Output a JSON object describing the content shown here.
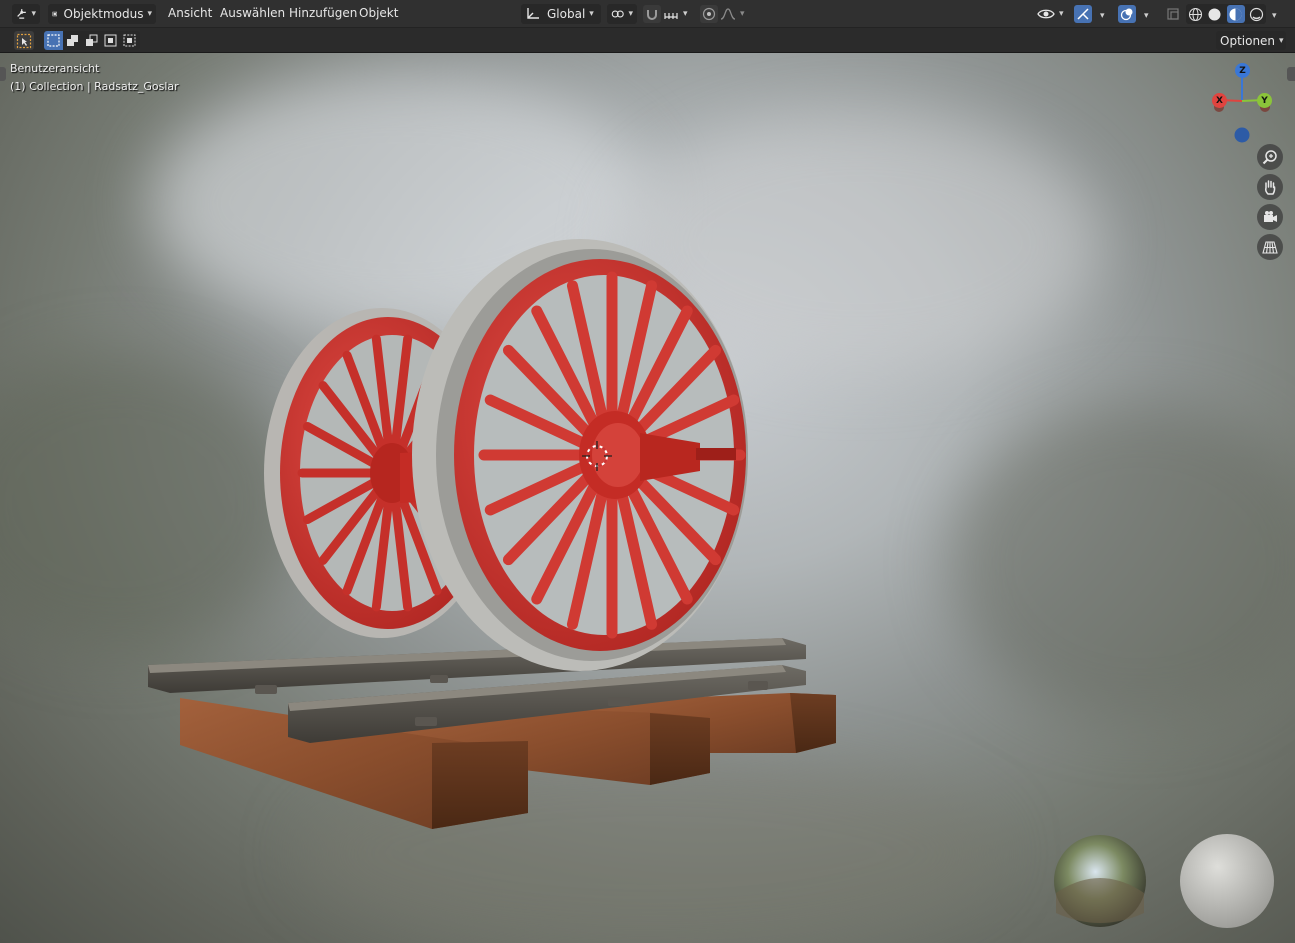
{
  "header": {
    "mode_label": "Objektmodus",
    "menus": [
      "Ansicht",
      "Auswählen",
      "Hinzufügen",
      "Objekt"
    ],
    "transform_orientation": "Global"
  },
  "toolbar": {
    "options_label": "Optionen"
  },
  "viewport": {
    "view_name": "Benutzeransicht",
    "collection_info": "(1) Collection | Radsatz_Goslar"
  },
  "gizmo": {
    "axis_x": "X",
    "axis_y": "Y",
    "axis_z": "Z",
    "colors": {
      "x": "#e0443f",
      "y": "#8bc43a",
      "z": "#3a77d6"
    }
  },
  "icons": [
    "editor-type-icon",
    "object-mode-icon",
    "transform-orientation-icon",
    "pivot-icon",
    "snap-magnet-icon",
    "snap-increment-icon",
    "proportional-edit-icon",
    "falloff-icon",
    "visibility-icon",
    "gizmo-icon",
    "overlay-icon",
    "xray-icon",
    "wireframe-shading-icon",
    "solid-shading-icon",
    "material-shading-icon",
    "rendered-shading-icon",
    "select-box-icon",
    "zoom-icon",
    "hand-pan-icon",
    "camera-icon",
    "perspective-grid-icon"
  ]
}
